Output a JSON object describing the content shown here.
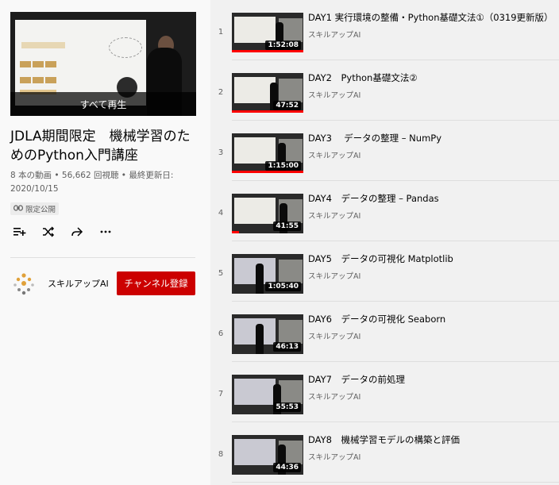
{
  "playlist": {
    "play_all_label": "すべて再生",
    "title": "JDLA期間限定　機械学習のためのPython入門講座",
    "stats": "8 本の動画 • 56,662 回視聴 • 最終更新日: 2020/10/15",
    "privacy": "限定公開",
    "actions": [
      "add-to-queue-icon",
      "shuffle-icon",
      "share-icon",
      "more-icon"
    ]
  },
  "owner": {
    "name": "スキルアップAI",
    "subscribe_label": "チャンネル登録"
  },
  "colors": {
    "subscribe": "#cc0000",
    "progress": "#ff0000",
    "background": "#f9f9f9",
    "list_background": "#f1f1f1"
  },
  "videos": [
    {
      "index": "1",
      "title": "DAY1 実行環境の整備・Python基礎文法①（0319更新版）",
      "channel": "スキルアップAI",
      "duration": "1:52:08",
      "watched": 1.0
    },
    {
      "index": "2",
      "title": "DAY2　Python基礎文法②",
      "channel": "スキルアップAI",
      "duration": "47:52",
      "watched": 1.0
    },
    {
      "index": "3",
      "title": "DAY3　 データの整理 – NumPy",
      "channel": "スキルアップAI",
      "duration": "1:15:00",
      "watched": 1.0
    },
    {
      "index": "4",
      "title": "DAY4　データの整理 – Pandas",
      "channel": "スキルアップAI",
      "duration": "41:55",
      "watched": 0.1
    },
    {
      "index": "5",
      "title": "DAY5　データの可視化 Matplotlib",
      "channel": "スキルアップAI",
      "duration": "1:05:40",
      "watched": 0
    },
    {
      "index": "6",
      "title": "DAY6　データの可視化 Seaborn",
      "channel": "スキルアップAI",
      "duration": "46:13",
      "watched": 0
    },
    {
      "index": "7",
      "title": "DAY7　データの前処理",
      "channel": "スキルアップAI",
      "duration": "55:53",
      "watched": 0
    },
    {
      "index": "8",
      "title": "DAY8　機械学習モデルの構築と評価",
      "channel": "スキルアップAI",
      "duration": "44:36",
      "watched": 0
    }
  ]
}
